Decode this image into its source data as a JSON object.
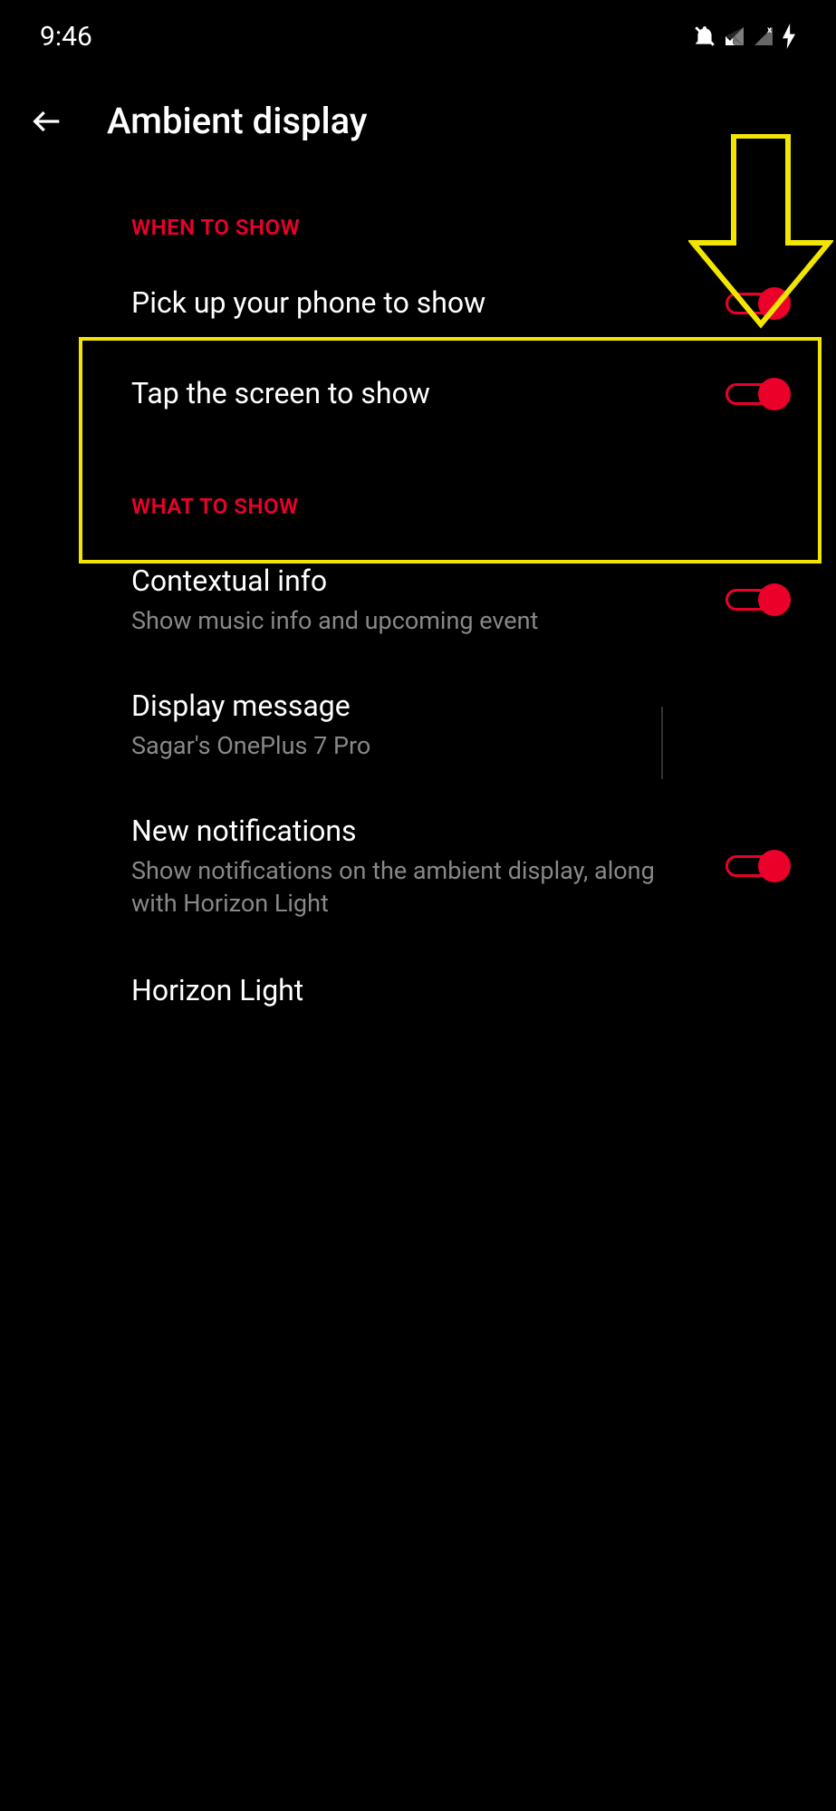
{
  "status_bar": {
    "time": "9:46"
  },
  "header": {
    "title": "Ambient display"
  },
  "sections": {
    "when_to_show": {
      "header": "WHEN TO SHOW",
      "items": [
        {
          "title": "Pick up your phone to show",
          "toggle": true
        },
        {
          "title": "Tap the screen to show",
          "toggle": true
        }
      ]
    },
    "what_to_show": {
      "header": "WHAT TO SHOW",
      "items": [
        {
          "title": "Contextual info",
          "subtitle": "Show music info and upcoming event",
          "toggle": true
        },
        {
          "title": "Display message",
          "subtitle": "Sagar's OnePlus 7 Pro"
        },
        {
          "title": "New notifications",
          "subtitle": "Show notifications on the ambient display, along with Horizon Light",
          "toggle": true
        },
        {
          "title": "Horizon Light"
        }
      ]
    }
  }
}
